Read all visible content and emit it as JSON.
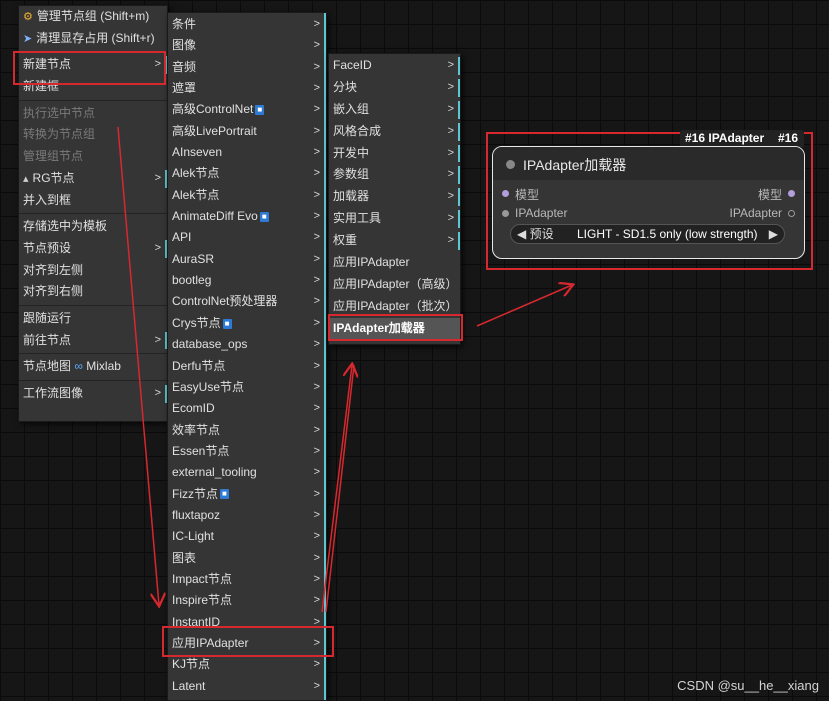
{
  "menu1": {
    "items": [
      {
        "label": "管理节点组 (Shift+m)",
        "icon": "org-chart-icon",
        "disabled": false,
        "sub": false
      },
      {
        "label": "清理显存占用 (Shift+r)",
        "icon": "rocket-icon",
        "disabled": false,
        "sub": false
      },
      {
        "label": "新建节点",
        "disabled": false,
        "sub": true
      },
      {
        "label": "新建框",
        "disabled": false,
        "sub": false
      },
      {
        "label": "执行选中节点",
        "disabled": true,
        "sub": false
      },
      {
        "label": "转换为节点组",
        "disabled": true,
        "sub": false
      },
      {
        "label": "管理组节点",
        "disabled": true,
        "sub": false
      },
      {
        "label": "RG节点",
        "icon": "rg-icon",
        "disabled": false,
        "sub": true
      },
      {
        "label": "并入到框",
        "disabled": false,
        "sub": false
      },
      {
        "label": "存储选中为模板",
        "disabled": false,
        "sub": false
      },
      {
        "label": "节点预设",
        "disabled": false,
        "sub": true
      },
      {
        "label": "对齐到左侧",
        "disabled": false,
        "sub": false
      },
      {
        "label": "对齐到右侧",
        "disabled": false,
        "sub": false
      },
      {
        "label": "跟随运行",
        "disabled": false,
        "sub": false
      },
      {
        "label": "前往节点",
        "disabled": false,
        "sub": true
      },
      {
        "label": "节点地图",
        "suffix": "Mixlab",
        "disabled": false,
        "sub": false
      },
      {
        "label": "工作流图像",
        "disabled": false,
        "sub": true
      }
    ]
  },
  "menu2": {
    "items": [
      "条件",
      "图像",
      "音频",
      "遮罩",
      "高级ControlNet",
      "高级LivePortrait",
      "AInseven",
      "Alek节点",
      "Alek节点",
      "AnimateDiff Evo",
      "API",
      "AuraSR",
      "bootleg",
      "ControlNet预处理器",
      "Crys节点",
      "database_ops",
      "Derfu节点",
      "EasyUse节点",
      "EcomID",
      "效率节点",
      "Essen节点",
      "external_tooling",
      "Fizz节点",
      "fluxtapoz",
      "IC-Light",
      "图表",
      "Impact节点",
      "Inspire节点",
      "InstantID",
      "应用IPAdapter",
      "KJ节点",
      "Latent"
    ]
  },
  "menu3": {
    "items": [
      {
        "label": "FaceID",
        "sub": true
      },
      {
        "label": "分块",
        "sub": true
      },
      {
        "label": "嵌入组",
        "sub": true
      },
      {
        "label": "风格合成",
        "sub": true
      },
      {
        "label": "开发中",
        "sub": true
      },
      {
        "label": "参数组",
        "sub": true
      },
      {
        "label": "加载器",
        "sub": true
      },
      {
        "label": "实用工具",
        "sub": true
      },
      {
        "label": "权重",
        "sub": true
      },
      {
        "label": "应用IPAdapter",
        "sub": false
      },
      {
        "label": "应用IPAdapter（高级）",
        "sub": false
      },
      {
        "label": "应用IPAdapter（批次）",
        "sub": false
      },
      {
        "label": "IPAdapter加载器",
        "sub": false
      }
    ]
  },
  "node": {
    "badge": "#16 IPAdapter",
    "badge_num": "#16",
    "title": "IPAdapter加载器",
    "inputs": [
      "模型",
      "IPAdapter"
    ],
    "outputs": [
      "模型",
      "IPAdapter"
    ],
    "widget_label": "预设",
    "widget_value": "LIGHT - SD1.5 only (low strength)"
  },
  "watermark": "CSDN @su__he__xiang",
  "colors": {
    "highlight": "#d6282f",
    "submenu_bar": "#5fc6d1",
    "menu_bg": "#353535"
  }
}
